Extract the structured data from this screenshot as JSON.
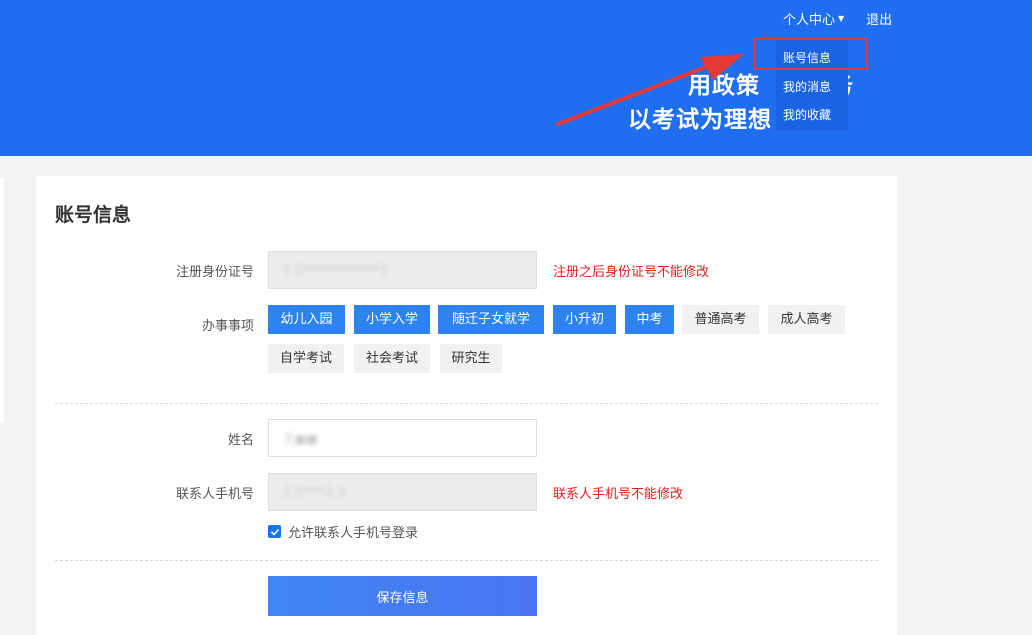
{
  "header": {
    "personal_center": "个人中心",
    "logout": "退出",
    "slogan_line1": "用政策",
    "slogan_line1_tail": "务",
    "slogan_line2": "以考试为理想"
  },
  "dropdown": {
    "items": [
      "账号信息",
      "我的消息",
      "我的收藏"
    ]
  },
  "card": {
    "title": "账号信息",
    "id_label": "注册身份证号",
    "id_value": "3 1*************2",
    "id_note": "注册之后身份证号不能修改",
    "business_label": "办事事项",
    "tags": [
      {
        "label": "幼儿入园",
        "selected": true
      },
      {
        "label": "小学入学",
        "selected": true
      },
      {
        "label": "随迁子女就学",
        "selected": true
      },
      {
        "label": "小升初",
        "selected": true
      },
      {
        "label": "中考",
        "selected": true
      },
      {
        "label": "普通高考",
        "selected": false
      },
      {
        "label": "成人高考",
        "selected": false
      },
      {
        "label": "自学考试",
        "selected": false
      },
      {
        "label": "社会考试",
        "selected": false
      },
      {
        "label": "研究生",
        "selected": false
      }
    ],
    "name_label": "姓名",
    "name_value": "王■■",
    "phone_label": "联系人手机号",
    "phone_value": "1 3****2 3",
    "phone_note": "联系人手机号不能修改",
    "allow_login_label": "允许联系人手机号登录",
    "allow_login_checked": true,
    "save_label": "保存信息"
  },
  "colors": {
    "banner": "#1f6ef0",
    "tag_selected": "#2d84f0",
    "warning": "#e02020",
    "highlight": "#e53935"
  }
}
